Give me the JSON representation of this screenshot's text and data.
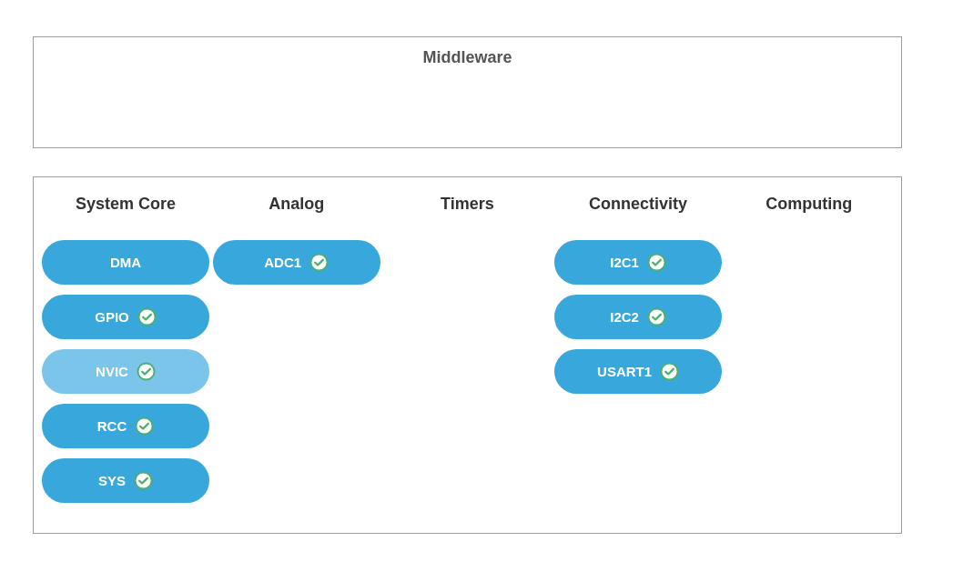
{
  "middleware": {
    "title": "Middleware"
  },
  "categories": [
    {
      "title": "System Core",
      "peripherals": [
        {
          "label": "DMA",
          "configured": false,
          "selected": false
        },
        {
          "label": "GPIO",
          "configured": true,
          "selected": false
        },
        {
          "label": "NVIC",
          "configured": true,
          "selected": true
        },
        {
          "label": "RCC",
          "configured": true,
          "selected": false
        },
        {
          "label": "SYS",
          "configured": true,
          "selected": false
        }
      ]
    },
    {
      "title": "Analog",
      "peripherals": [
        {
          "label": "ADC1",
          "configured": true,
          "selected": false
        }
      ]
    },
    {
      "title": "Timers"
    },
    {
      "title": "Connectivity",
      "peripherals": [
        {
          "label": "I2C1",
          "configured": true,
          "selected": false
        },
        {
          "label": "I2C2",
          "configured": true,
          "selected": false
        },
        {
          "label": "USART1",
          "configured": true,
          "selected": false
        }
      ]
    },
    {
      "title": "Computing"
    }
  ]
}
